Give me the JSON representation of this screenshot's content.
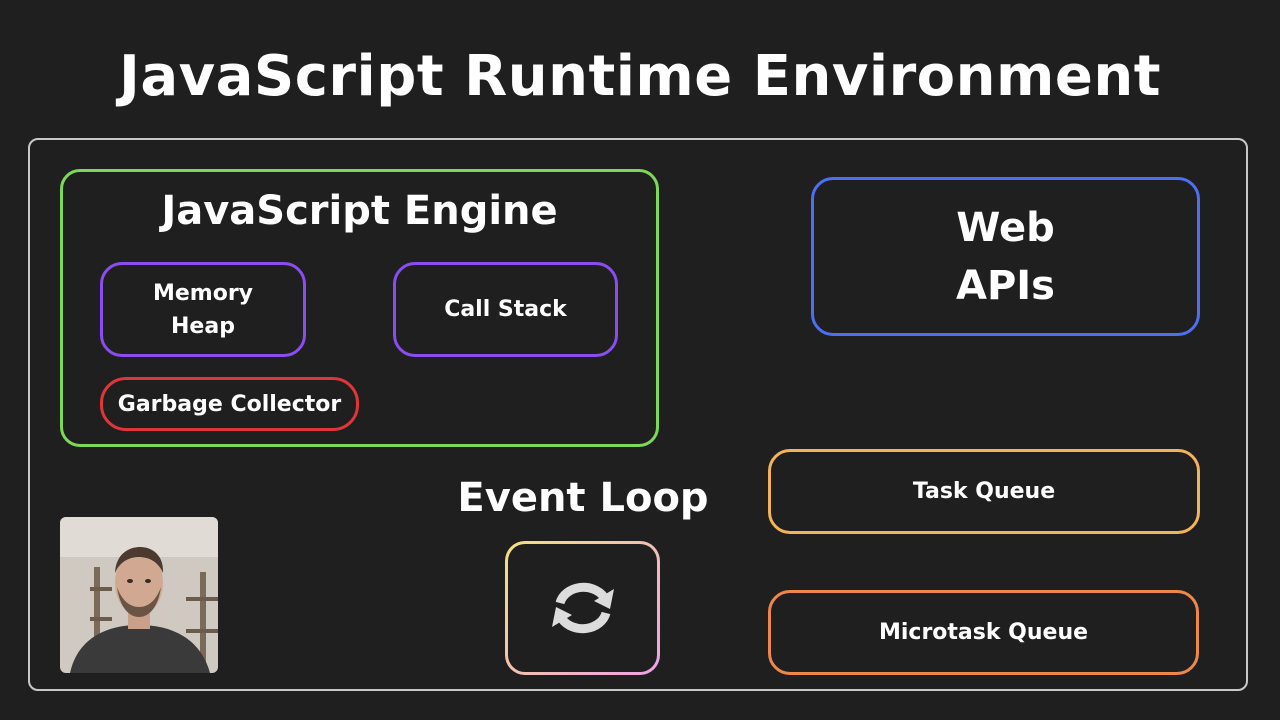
{
  "title": "JavaScript Runtime Environment",
  "engine": {
    "title": "JavaScript Engine",
    "memory_heap": [
      "Memory",
      "Heap"
    ],
    "call_stack": "Call Stack",
    "garbage_collector": "Garbage Collector"
  },
  "web_apis": [
    "Web",
    "APIs"
  ],
  "event_loop": {
    "label": "Event Loop",
    "icon": "refresh-cycle-icon"
  },
  "queues": {
    "task": "Task Queue",
    "microtask": "Microtask Queue"
  },
  "colors": {
    "background": "#1f1f1f",
    "runtime_border": "#c8c8c8",
    "engine_border": "#7dd85a",
    "memory_border": "#8a4df0",
    "gc_border": "#e0353b",
    "web_apis_border": "#4d6ff0",
    "task_queue_border": "#f3b35a",
    "microtask_queue_border": "#f0874a",
    "event_loop_gradient_start": "#f4e27a",
    "event_loop_gradient_end": "#f0a0e8"
  },
  "webcam": {
    "icon": "presenter-webcam-thumbnail"
  }
}
